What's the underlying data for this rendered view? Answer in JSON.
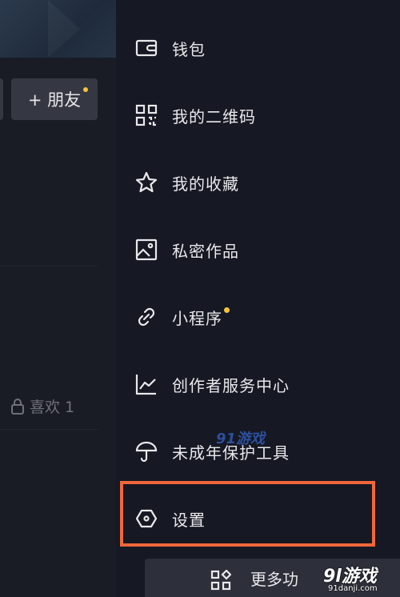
{
  "left_panel": {
    "friend_button": "+ 朋友",
    "likes_label": "喜欢 1"
  },
  "menu": {
    "items": [
      {
        "label": "钱包",
        "icon": "wallet-icon"
      },
      {
        "label": "我的二维码",
        "icon": "qrcode-icon"
      },
      {
        "label": "我的收藏",
        "icon": "star-icon"
      },
      {
        "label": "私密作品",
        "icon": "image-icon"
      },
      {
        "label": "小程序",
        "icon": "link-icon",
        "has_dot": true
      },
      {
        "label": "创作者服务中心",
        "icon": "chart-icon"
      },
      {
        "label": "未成年保护工具",
        "icon": "umbrella-icon"
      },
      {
        "label": "设置",
        "icon": "settings-hexagon-icon",
        "highlighted": true
      }
    ]
  },
  "more_button": {
    "label": "更多功"
  },
  "watermark": {
    "center": "91游戏",
    "corner_big": "9l游戏",
    "corner_small": "91danji.com"
  },
  "colors": {
    "background": "#161823",
    "accent_dot": "#f5c33b",
    "highlight": "#f0673b"
  }
}
